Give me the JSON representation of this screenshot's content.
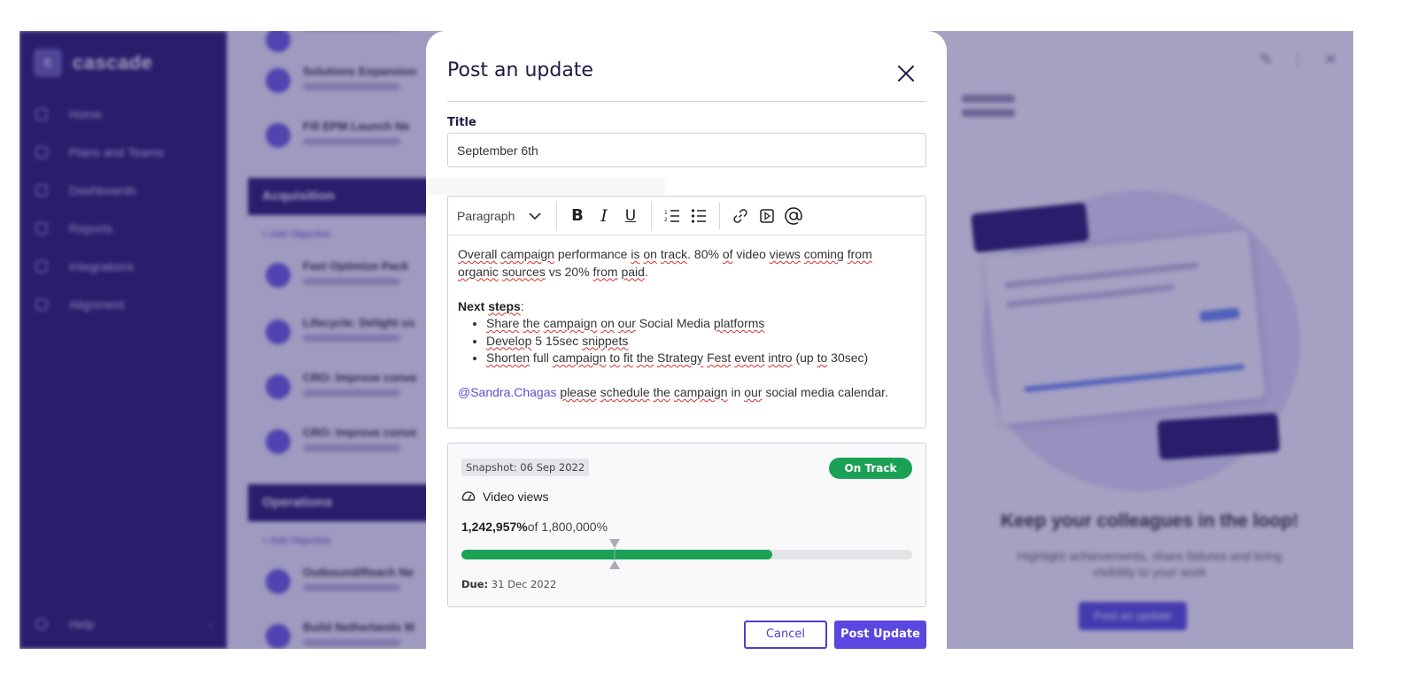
{
  "app": {
    "logo_text": "cascade",
    "nav_items": [
      "Home",
      "Plans and Teams",
      "Dashboards",
      "Reports",
      "Integrations",
      "Alignment"
    ],
    "help_label": "Help",
    "sections": [
      {
        "title": "Acquisition",
        "link": "+ Add Objective"
      },
      {
        "title": "Operations",
        "link": "+ Add Objective"
      }
    ],
    "objective_titles": [
      "Solutions Expansion",
      "Fill EPM Launch Ne",
      "Fast Optimize Pack",
      "Lifecycle: Delight us",
      "CRO: Improve conve",
      "CRO: Improve conve",
      "Outbound/Reach Ne",
      "Build Netherlands M"
    ],
    "right_pane": {
      "title": "Keep your colleagues in the loop!",
      "description": "Highlight achievements, share failures and bring visibility to your work",
      "button": "Post an update"
    }
  },
  "modal": {
    "title": "Post an update",
    "title_label": "Title",
    "title_value": "September 6th",
    "toolbar": {
      "paragraph_label": "Paragraph",
      "bold": "B",
      "italic": "I",
      "underline": "U"
    },
    "body": {
      "intro": "Overall campaign performance is on track. 80% of video views coming from organic sources vs 20% from paid.",
      "next_steps_heading": "Next steps",
      "steps": [
        "Share the campaign on our Social Media platforms",
        "Develop 5 15sec snippets",
        "Shorten full campaign to fit the Strategy Fest event intro (up to 30sec)"
      ],
      "mention": "@Sandra.Chagas",
      "mention_text": " please schedule the campaign in our social media calendar."
    },
    "snapshot": {
      "label": "Snapshot: 06 Sep 2022",
      "status": "On Track",
      "status_color": "#1aa156",
      "metric_name": "Video views",
      "current_value": "1,242,957%",
      "target_text": "of 1,800,000%",
      "progress_fraction": 0.69,
      "marker_fraction": 0.34,
      "due_label": "Due:",
      "due_value": "31 Dec 2022"
    },
    "buttons": {
      "cancel": "Cancel",
      "post": "Post Update"
    }
  }
}
